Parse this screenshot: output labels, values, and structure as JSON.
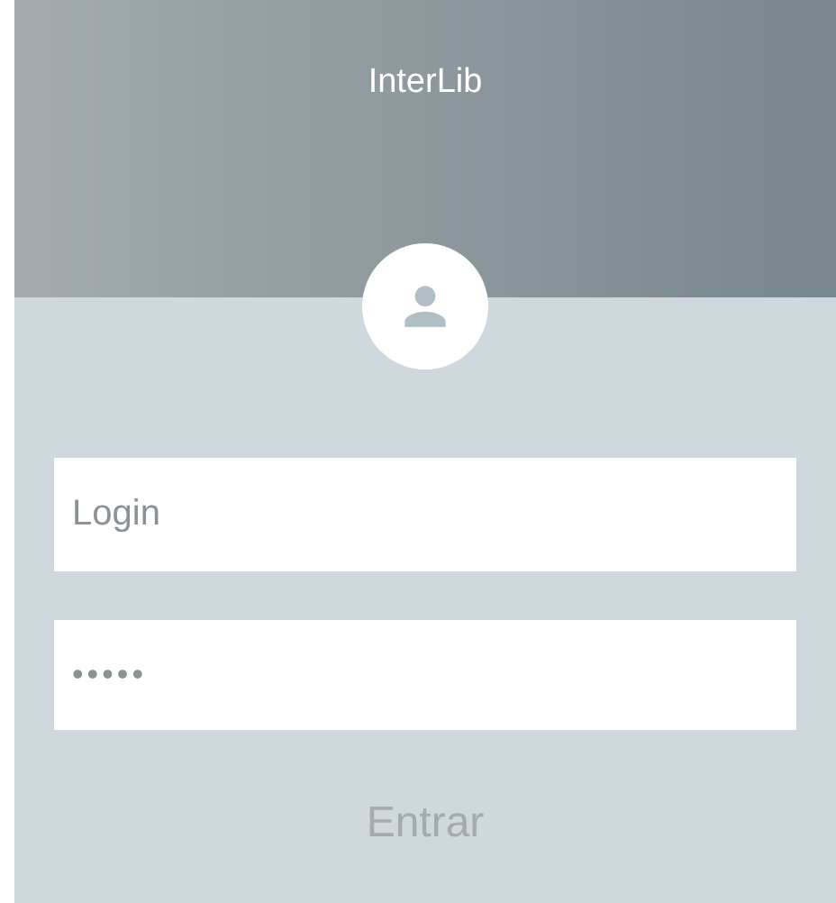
{
  "header": {
    "title": "InterLib"
  },
  "form": {
    "login": {
      "placeholder": "Login"
    },
    "password": {
      "placeholder": "•••••"
    },
    "submit": {
      "label": "Entrar",
      "disabled": true
    }
  }
}
